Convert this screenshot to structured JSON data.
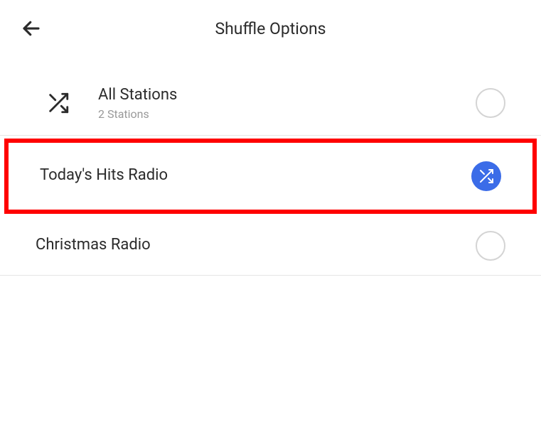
{
  "header": {
    "title": "Shuffle Options"
  },
  "items": [
    {
      "title": "All Stations",
      "subtitle": "2 Stations",
      "selected": false,
      "hasLeadingIcon": true
    },
    {
      "title": "Today's Hits Radio",
      "subtitle": "",
      "selected": true,
      "hasLeadingIcon": false
    },
    {
      "title": "Christmas Radio",
      "subtitle": "",
      "selected": false,
      "hasLeadingIcon": false
    }
  ]
}
